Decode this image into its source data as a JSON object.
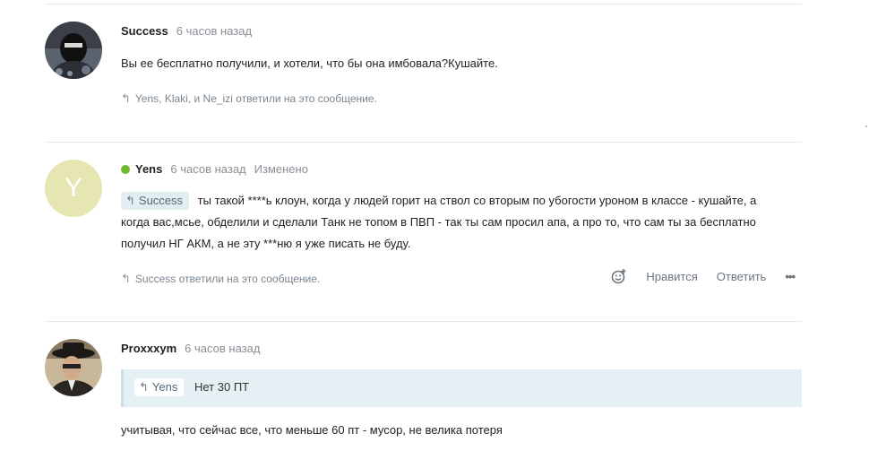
{
  "comments": [
    {
      "author": "Success",
      "time": "6 часов назад",
      "text": "Вы ее бесплатно получили, и хотели, что бы она имбовала?Кушайте.",
      "replies": "Yens, Klaki, и Ne_izi ответили на это сообщение."
    },
    {
      "author": "Yens",
      "avatar_letter": "Y",
      "time": "6 часов назад",
      "edited": "Изменено",
      "quote_author": "Success",
      "text_line1": "ты такой ****ь клоун, когда у людей горит на ствол со вторым по убогости уроном в классе - кушайте, а",
      "text_line2": "когда вас,мсье, обделили и сделали Танк не топом в ПВП - так ты сам просил апа, а про то, что сам ты за бесплатно",
      "text_line3": "получил НГ АКМ, а не эту ***ню я уже писать не буду.",
      "replies": "Success ответили на это сообщение.",
      "actions": {
        "like": "Нравится",
        "reply": "Ответить",
        "more": "•••"
      }
    },
    {
      "author": "Proxxxym",
      "time": "6 часов назад",
      "quote_author": "Yens",
      "quote_text": "Нет 30 ПТ",
      "text": "учитывая, что сейчас все, что меньше 60 пт - мусор, не велика потеря"
    }
  ],
  "colors": {
    "online": "#6dbb2a",
    "quote_bg": "#e5f0f4",
    "avatar_y_bg": "#e6e6b3"
  },
  "icons": {
    "reply": "reply-arrow-icon",
    "react": "add-reaction-icon"
  }
}
